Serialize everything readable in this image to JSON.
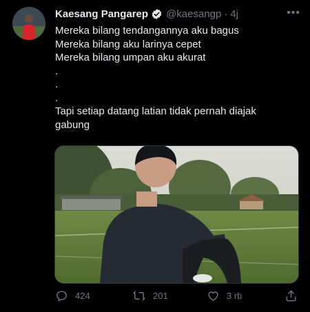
{
  "tweet": {
    "author_name": "Kaesang Pangarep",
    "author_handle": "@kaesangp",
    "separator": "·",
    "time": "4j",
    "more_label": "•••",
    "lines": [
      "Mereka bilang tendangannya aku bagus",
      "Mereka bilang aku larinya cepet",
      "Mereka bilang umpan aku akurat",
      ".",
      ".",
      ".",
      "Tapi setiap datang latian tidak pernah diajak gabung"
    ]
  },
  "actions": {
    "reply_count": "424",
    "retweet_count": "201",
    "like_count": "3 rb"
  },
  "icons": {
    "verified": "verified-badge-icon",
    "reply": "comment-bubble-icon",
    "retweet": "retweet-arrows-icon",
    "like": "heart-icon",
    "share": "share-upload-icon",
    "more": "more-horizontal-icon"
  },
  "colors": {
    "background": "#000000",
    "text": "#e7e9ea",
    "muted": "#71767b",
    "verified": "#e7e9ea"
  }
}
